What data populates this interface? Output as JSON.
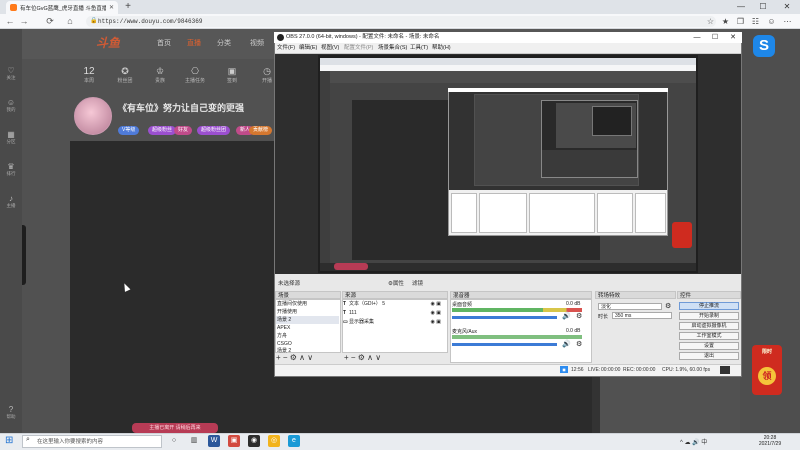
{
  "browser": {
    "tab_title": "有车位GvG蓝鹰_虎牙直播 斗鱼直播",
    "url": "https://www.douyu.com/9846369",
    "new_tab": "+",
    "controls": {
      "minimize": "—",
      "maximize": "☐",
      "close": "✕"
    },
    "nav": {
      "back": "←",
      "forward": "→",
      "reload": "⟳",
      "home": "⌂"
    }
  },
  "site": {
    "logo_text": "斗鱼",
    "nav_items": [
      "首页",
      "直播",
      "分类",
      "视频"
    ],
    "left_rail": [
      "关注",
      "我的",
      "分区",
      "排行",
      "主播",
      "服务",
      "帮助"
    ],
    "stats": [
      {
        "value": "12",
        "label": "本周"
      },
      {
        "value": "",
        "label": "粉丝团"
      },
      {
        "value": "",
        "label": "贵族"
      },
      {
        "value": "",
        "label": "主播任务"
      },
      {
        "value": "",
        "label": "签到"
      },
      {
        "value": "",
        "label": "开播"
      }
    ],
    "stream_title": "《有车位》努力让自己变的更强",
    "stream_tag": "直播",
    "badges": [
      "V等级",
      "超级粉丝",
      "好友",
      "超级粉丝团",
      "新人",
      "贡献榜"
    ],
    "bottom_chip": "主播已离开 请稍后再来",
    "right_logo": "S",
    "gift_title": "限时",
    "gift_label": "领"
  },
  "obs": {
    "title": "OBS 27.0.0 (64-bit, windows) - 配置文件: 未命名 - 场景: 未命名",
    "menu": [
      "文件(F)",
      "编辑(E)",
      "视图(V)",
      "配置文件(P)",
      "场景集合(S)",
      "工具(T)",
      "帮助(H)"
    ],
    "selected_source_label": "未选择源",
    "properties": "⚙属性",
    "filters": "滤镜",
    "docks": {
      "scenes": "场景",
      "sources": "来源",
      "mixer": "混音器",
      "transitions": "转场特效",
      "controls": "控件"
    },
    "scenes": [
      "直播间仅使用",
      "开播使用",
      "场景 2",
      "APEX",
      "方舟",
      "CSGO",
      "场景 2"
    ],
    "selected_scene_index": 2,
    "sources": [
      {
        "icon": "T",
        "name": "文本（GDI+） 5"
      },
      {
        "icon": "T",
        "name": "111"
      },
      {
        "icon": "▭",
        "name": "显示器采集"
      }
    ],
    "mixer": [
      {
        "name": "桌面音频",
        "db": "0.0 dB"
      },
      {
        "name": "麦克风/Aux",
        "db": "0.0 dB"
      }
    ],
    "transition": "淡化",
    "duration_label": "时长",
    "duration": "350 ms",
    "controls": [
      "停止推流",
      "开始录制",
      "启动虚拟摄像机",
      "工作室模式",
      "设置",
      "退出"
    ],
    "tools_glyphs": "+ − ⚙ ∧ ∨",
    "status": {
      "live_label": "LIVE:",
      "live_time": "00:00:00",
      "rec_label": "REC:",
      "rec_time": "00:00:00",
      "cpu": "CPU: 1.9%, 60.00 fps",
      "kb": "12:56"
    }
  },
  "taskbar": {
    "start": "⊞",
    "search_placeholder": "在这里输入你要搜索的内容",
    "search_icon": "⌕",
    "tray": "^ ☁ 🔊 中",
    "time": "20:28",
    "date": "2021/7/29"
  },
  "colors": {
    "douyu_orange": "#e2622e",
    "douyu_blue": "#1e87e8",
    "obs_dark": "#2e2e2e",
    "taskbar": "#e9ecf0"
  }
}
